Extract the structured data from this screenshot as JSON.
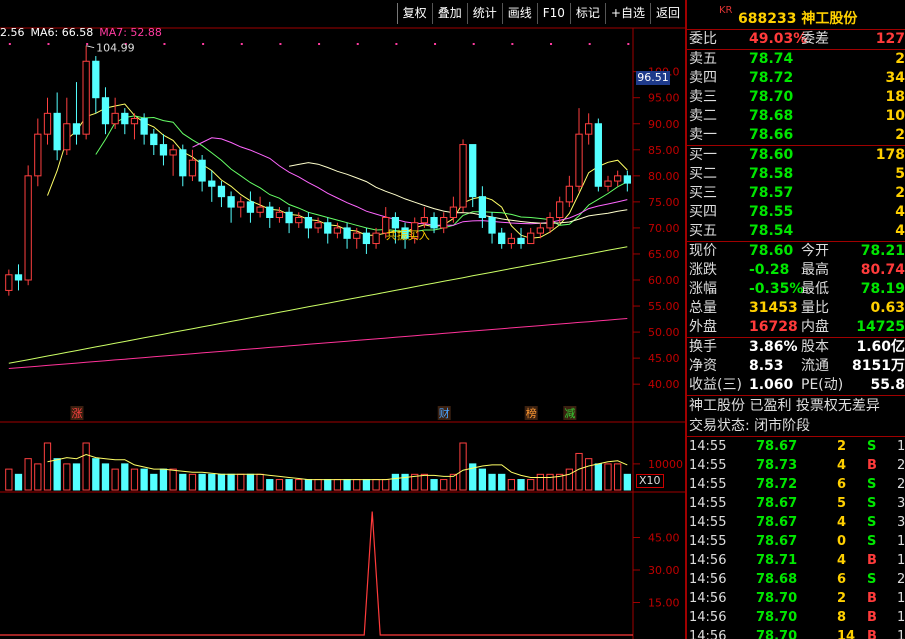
{
  "toolbar": {
    "buttons": [
      "复权",
      "叠加",
      "统计",
      "画线",
      "F10",
      "标记",
      "+自选",
      "返回"
    ]
  },
  "ma_legend": [
    {
      "label": "2.56",
      "color": "#ffffff"
    },
    {
      "label": "MA6: 66.58",
      "color": "#ffffff"
    },
    {
      "label": "MA7: 52.88",
      "color": "#ff3ba0"
    }
  ],
  "chart_labels": {
    "high_label": "104.99",
    "current_price_tag": "96.51",
    "signal_text": "共振买入",
    "x10": "X10",
    "event_tags": [
      {
        "text": "涨",
        "color": "#ff4040"
      },
      {
        "text": "财",
        "color": "#4aa3ff"
      },
      {
        "text": "榜",
        "color": "#ff9933"
      },
      {
        "text": "减",
        "color": "#33cc33"
      }
    ]
  },
  "chart_data": {
    "type": "candlestick",
    "price_axis": {
      "ticks": [
        40,
        45,
        50,
        55,
        60,
        65,
        70,
        75,
        80,
        85,
        90,
        95,
        100
      ],
      "labels": [
        "40.00",
        "45.00",
        "50.00",
        "55.00",
        "60.00",
        "65.00",
        "70.00",
        "75.00",
        "80.00",
        "85.00",
        "90.00",
        "95.00",
        "100.0"
      ],
      "ylim": [
        36,
        108
      ]
    },
    "volume_axis": {
      "ticks": [
        10000
      ],
      "labels": [
        "10000"
      ]
    },
    "indicator_axis": {
      "ticks": [
        15,
        30,
        45
      ],
      "labels": [
        "15.00",
        "30.00",
        "45.00"
      ],
      "ylim": [
        0,
        60
      ]
    },
    "candles": [
      [
        58,
        61,
        57,
        62
      ],
      [
        61,
        60,
        58,
        63
      ],
      [
        60,
        80,
        59,
        82
      ],
      [
        80,
        88,
        78,
        91
      ],
      [
        88,
        92,
        86,
        95
      ],
      [
        92,
        85,
        83,
        96
      ],
      [
        85,
        90,
        84,
        95
      ],
      [
        90,
        88,
        86,
        98
      ],
      [
        88,
        102,
        87,
        105
      ],
      [
        102,
        95,
        92,
        103
      ],
      [
        95,
        90,
        88,
        97
      ],
      [
        90,
        92,
        89,
        95
      ],
      [
        92,
        90,
        88,
        93
      ],
      [
        90,
        91,
        87,
        92
      ],
      [
        91,
        88,
        86,
        92
      ],
      [
        88,
        86,
        84,
        89
      ],
      [
        86,
        84,
        82,
        88
      ],
      [
        84,
        85,
        80,
        86
      ],
      [
        85,
        80,
        78,
        86
      ],
      [
        80,
        83,
        79,
        85
      ],
      [
        83,
        79,
        77,
        84
      ],
      [
        79,
        78,
        75,
        81
      ],
      [
        78,
        76,
        74,
        79
      ],
      [
        76,
        74,
        71,
        77
      ],
      [
        74,
        75,
        72,
        76
      ],
      [
        75,
        73,
        71,
        77
      ],
      [
        73,
        74,
        72,
        76
      ],
      [
        74,
        72,
        70,
        75
      ],
      [
        72,
        73,
        71,
        74
      ],
      [
        73,
        71,
        69,
        74
      ],
      [
        71,
        72,
        70,
        73
      ],
      [
        72,
        70,
        68,
        73
      ],
      [
        70,
        71,
        69,
        72
      ],
      [
        71,
        69,
        67,
        72
      ],
      [
        69,
        70,
        68,
        71
      ],
      [
        70,
        68,
        66,
        71
      ],
      [
        68,
        69,
        66,
        70
      ],
      [
        69,
        67,
        65,
        70
      ],
      [
        67,
        69,
        66,
        70
      ],
      [
        69,
        72,
        68,
        74
      ],
      [
        72,
        70,
        67,
        73
      ],
      [
        70,
        68,
        66,
        71
      ],
      [
        68,
        71,
        67,
        72
      ],
      [
        71,
        72,
        70,
        74
      ],
      [
        72,
        70,
        69,
        73
      ],
      [
        70,
        72,
        69,
        73
      ],
      [
        72,
        74,
        71,
        76
      ],
      [
        74,
        86,
        73,
        87
      ],
      [
        86,
        76,
        74,
        80
      ],
      [
        76,
        72,
        70,
        78
      ],
      [
        72,
        69,
        67,
        73
      ],
      [
        69,
        67,
        66,
        70
      ],
      [
        67,
        68,
        66,
        69
      ],
      [
        68,
        67,
        66,
        70
      ],
      [
        67,
        69,
        67,
        70
      ],
      [
        69,
        70,
        68,
        71
      ],
      [
        70,
        72,
        69,
        73
      ],
      [
        72,
        75,
        71,
        76
      ],
      [
        75,
        78,
        74,
        80
      ],
      [
        78,
        88,
        77,
        93
      ],
      [
        88,
        90,
        86,
        92
      ],
      [
        90,
        78,
        77,
        91
      ],
      [
        78,
        79,
        77,
        80
      ],
      [
        79,
        80,
        78,
        81
      ],
      [
        80,
        78.6,
        77,
        81
      ]
    ],
    "volumes": [
      4,
      3,
      6,
      5,
      9,
      6,
      5,
      5,
      9,
      6,
      5,
      4,
      5,
      4,
      4,
      3,
      4,
      4,
      3,
      3,
      3,
      3,
      3,
      3,
      3,
      3,
      3,
      2,
      2,
      2,
      2,
      2,
      2,
      2,
      2,
      2,
      2,
      2,
      2,
      2,
      3,
      3,
      3,
      3,
      2,
      2,
      3,
      9,
      5,
      4,
      3,
      3,
      2,
      2,
      2,
      3,
      3,
      3,
      4,
      7,
      6,
      5,
      5,
      5,
      3
    ],
    "indicator_values": [
      0,
      0,
      0,
      0,
      0,
      0,
      0,
      0,
      0,
      0,
      0,
      0,
      0,
      0,
      0,
      0,
      0,
      0,
      0,
      0,
      0,
      0,
      0,
      0,
      0,
      0,
      0,
      0,
      0,
      0,
      0,
      0,
      0,
      0,
      0,
      0,
      0,
      0,
      0,
      0,
      0,
      0,
      0,
      0,
      0,
      0,
      0,
      0,
      0,
      0,
      0,
      0,
      0,
      0,
      0,
      0,
      0,
      0,
      0,
      0,
      0,
      0,
      0,
      0,
      0
    ],
    "indicator_spike": {
      "index_frac": 0.588,
      "value": 57
    }
  },
  "quote": {
    "kr": "KR",
    "title": "688233 神工股份",
    "order_rows": [
      {
        "l1": "委比",
        "v1": "49.03%",
        "c1": "red",
        "l2": "委差",
        "v2": "127",
        "c2": "red"
      }
    ],
    "sell_rows": [
      {
        "label": "卖五",
        "price": "78.74",
        "vol": "2"
      },
      {
        "label": "卖四",
        "price": "78.72",
        "vol": "34"
      },
      {
        "label": "卖三",
        "price": "78.70",
        "vol": "18"
      },
      {
        "label": "卖二",
        "price": "78.68",
        "vol": "10"
      },
      {
        "label": "卖一",
        "price": "78.66",
        "vol": "2"
      }
    ],
    "buy_rows": [
      {
        "label": "买一",
        "price": "78.60",
        "vol": "178"
      },
      {
        "label": "买二",
        "price": "78.58",
        "vol": "5"
      },
      {
        "label": "买三",
        "price": "78.57",
        "vol": "2"
      },
      {
        "label": "买四",
        "price": "78.55",
        "vol": "4"
      },
      {
        "label": "买五",
        "price": "78.54",
        "vol": "4"
      }
    ],
    "stats_rows": [
      {
        "l1": "现价",
        "v1": "78.60",
        "c1": "green",
        "l2": "今开",
        "v2": "78.21",
        "c2": "green"
      },
      {
        "l1": "涨跌",
        "v1": "-0.28",
        "c1": "green",
        "l2": "最高",
        "v2": "80.74",
        "c2": "red"
      },
      {
        "l1": "涨幅",
        "v1": "-0.35%",
        "c1": "green",
        "l2": "最低",
        "v2": "78.19",
        "c2": "green"
      },
      {
        "l1": "总量",
        "v1": "31453",
        "c1": "yellow",
        "l2": "量比",
        "v2": "0.63",
        "c2": "yellow"
      },
      {
        "l1": "外盘",
        "v1": "16728",
        "c1": "red",
        "l2": "内盘",
        "v2": "14725",
        "c2": "green"
      }
    ],
    "fund_rows": [
      {
        "l1": "换手",
        "v1": "3.86%",
        "c1": "white",
        "l2": "股本",
        "v2": "1.60亿",
        "c2": "white"
      },
      {
        "l1": "净资",
        "v1": "8.53",
        "c1": "white",
        "l2": "流通",
        "v2": "8151万",
        "c2": "white"
      },
      {
        "l1": "收益(三)",
        "v1": "1.060",
        "c1": "white",
        "l2": "PE(动)",
        "v2": "55.8",
        "c2": "white"
      }
    ],
    "info_lines": [
      "神工股份 已盈利 投票权无差异",
      "交易状态: 闭市阶段"
    ],
    "ticks": [
      {
        "time": "14:55",
        "price": "78.67",
        "vol": "2",
        "bs": "S",
        "num": "1"
      },
      {
        "time": "14:55",
        "price": "78.73",
        "vol": "4",
        "bs": "B",
        "num": "2"
      },
      {
        "time": "14:55",
        "price": "78.72",
        "vol": "6",
        "bs": "S",
        "num": "2"
      },
      {
        "time": "14:55",
        "price": "78.67",
        "vol": "5",
        "bs": "S",
        "num": "3"
      },
      {
        "time": "14:55",
        "price": "78.67",
        "vol": "4",
        "bs": "S",
        "num": "3"
      },
      {
        "time": "14:55",
        "price": "78.67",
        "vol": "0",
        "bs": "S",
        "num": "1"
      },
      {
        "time": "14:56",
        "price": "78.71",
        "vol": "4",
        "bs": "B",
        "num": "1"
      },
      {
        "time": "14:56",
        "price": "78.68",
        "vol": "6",
        "bs": "S",
        "num": "2"
      },
      {
        "time": "14:56",
        "price": "78.70",
        "vol": "2",
        "bs": "B",
        "num": "1"
      },
      {
        "time": "14:56",
        "price": "78.70",
        "vol": "8",
        "bs": "B",
        "num": "1"
      },
      {
        "time": "14:56",
        "price": "78.70",
        "vol": "14",
        "bs": "B",
        "num": "1"
      }
    ]
  }
}
